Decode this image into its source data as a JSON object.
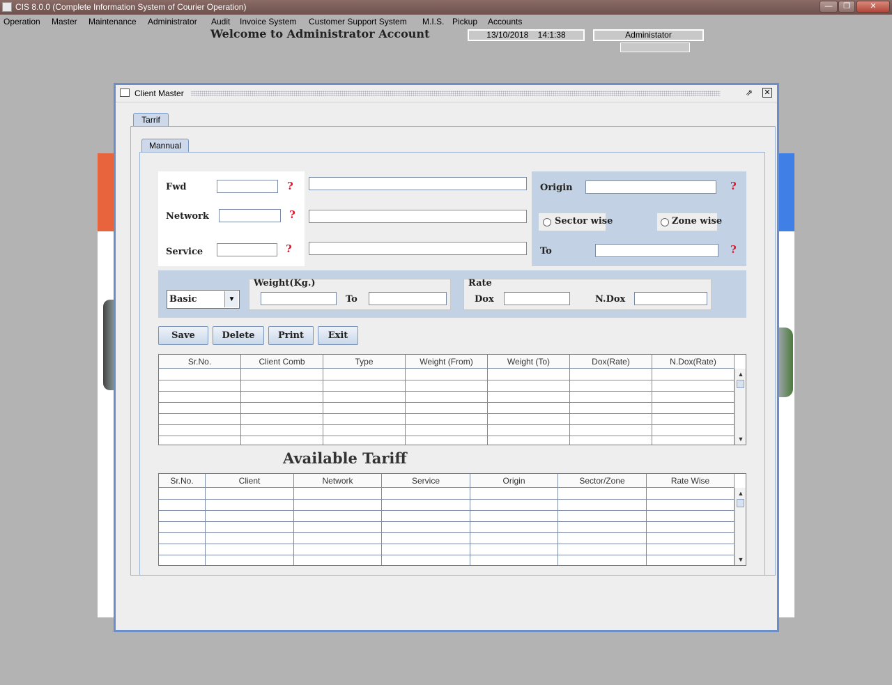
{
  "app": {
    "title": "CIS 8.0.0 (Complete Information System of Courier Operation)",
    "window_controls": [
      "minimize",
      "maximize",
      "close"
    ]
  },
  "menubar": {
    "items": [
      "Operation",
      "Master",
      "Maintenance",
      "Administrator",
      "Audit",
      "Invoice System",
      "Customer Support System",
      "M.I.S.",
      "Pickup",
      "Accounts"
    ]
  },
  "header": {
    "welcome": "Welcome to Administrator Account",
    "date": "13/10/2018",
    "time": "14:1:38",
    "user": "Administator"
  },
  "frame": {
    "title": "Client Master",
    "outer_tab": "Tarrif",
    "inner_tab": "Mannual",
    "fields": {
      "fwd_label": "Fwd",
      "network_label": "Network",
      "service_label": "Service",
      "origin_label": "Origin",
      "to_label": "To",
      "sector_wise": "Sector wise",
      "zone_wise": "Zone wise"
    },
    "rate_section": {
      "type_selected": "Basic",
      "weight_legend": "Weight(Kg.)",
      "weight_to_label": "To",
      "rate_legend": "Rate",
      "dox_label": "Dox",
      "ndox_label": "N.Dox"
    },
    "buttons": {
      "save": "Save",
      "delete": "Delete",
      "print": "Print",
      "exit": "Exit"
    },
    "tariff_table": {
      "columns": [
        "Sr.No.",
        "Client Comb",
        "Type",
        "Weight (From)",
        "Weight (To)",
        "Dox(Rate)",
        "N.Dox(Rate)"
      ],
      "rows": []
    },
    "available_title": "Available Tariff",
    "available_table": {
      "columns": [
        "Sr.No.",
        "Client",
        "Network",
        "Service",
        "Origin",
        "Sector/Zone",
        "Rate Wise"
      ],
      "rows": []
    }
  },
  "colors": {
    "frame_border": "#6b8ec9",
    "panel_blue": "#c2d1e4",
    "required_mark": "#e0142e",
    "desktop": "#b3b3b3"
  }
}
